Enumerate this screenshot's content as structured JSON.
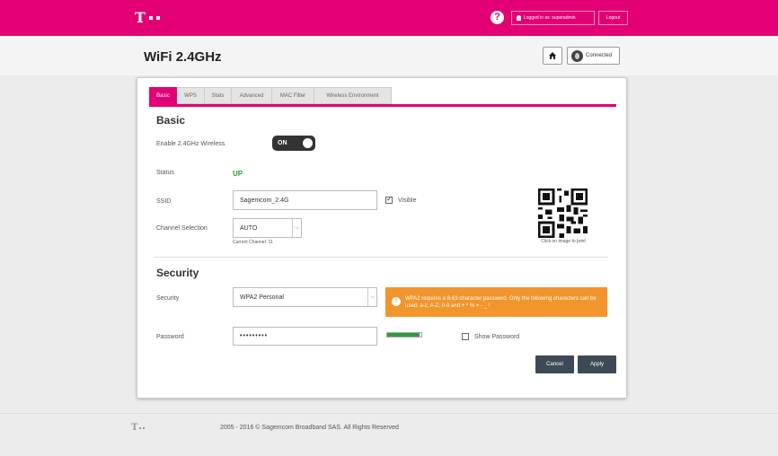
{
  "header": {
    "logo_letter": "T",
    "help_symbol": "?",
    "login_text": "Logged in as: superadmin",
    "logout_label": "Logout"
  },
  "page": {
    "title": "WiFi 2.4GHz",
    "connected_label": "Connected"
  },
  "tabs": [
    {
      "label": "Basic",
      "active": true
    },
    {
      "label": "WPS",
      "active": false
    },
    {
      "label": "Stats",
      "active": false
    },
    {
      "label": "Advanced",
      "active": false
    },
    {
      "label": "MAC Filter",
      "active": false
    },
    {
      "label": "Wireless Environment",
      "active": false
    }
  ],
  "basic": {
    "section_title": "Basic",
    "enable_label": "Enable 2.4GHz Wireless",
    "toggle_value": "ON",
    "status_label": "Status",
    "status_value": "UP",
    "ssid_label": "SSID",
    "ssid_value": "Sagemcom_2.4G",
    "visible_label": "Visible",
    "channel_label": "Channel Selection",
    "channel_value": "AUTO",
    "current_channel": "Current Channel: 11",
    "qr_caption": "Click on image to print"
  },
  "security": {
    "section_title": "Security",
    "security_label": "Security",
    "security_value": "WPA2 Personal",
    "warning_text": "WPA2 requires a 8-63 character password. Only the following characters can be used: a-z, A-Z, 0-9 and + * % = - _ !",
    "warning_symbol": "!",
    "password_label": "Password",
    "password_value": "•••••••••",
    "password_strength": 0.95,
    "show_password_label": "Show Password"
  },
  "actions": {
    "cancel_label": "Cancel",
    "apply_label": "Apply"
  },
  "footer": {
    "copyright": "2005 - 2016 © Sagemcom Broadband SAS. All Rights Reserved"
  },
  "colors": {
    "brand": "#e20074",
    "status_ok": "#2e9c3a",
    "warning": "#f2952c",
    "button": "#3d4a55"
  }
}
